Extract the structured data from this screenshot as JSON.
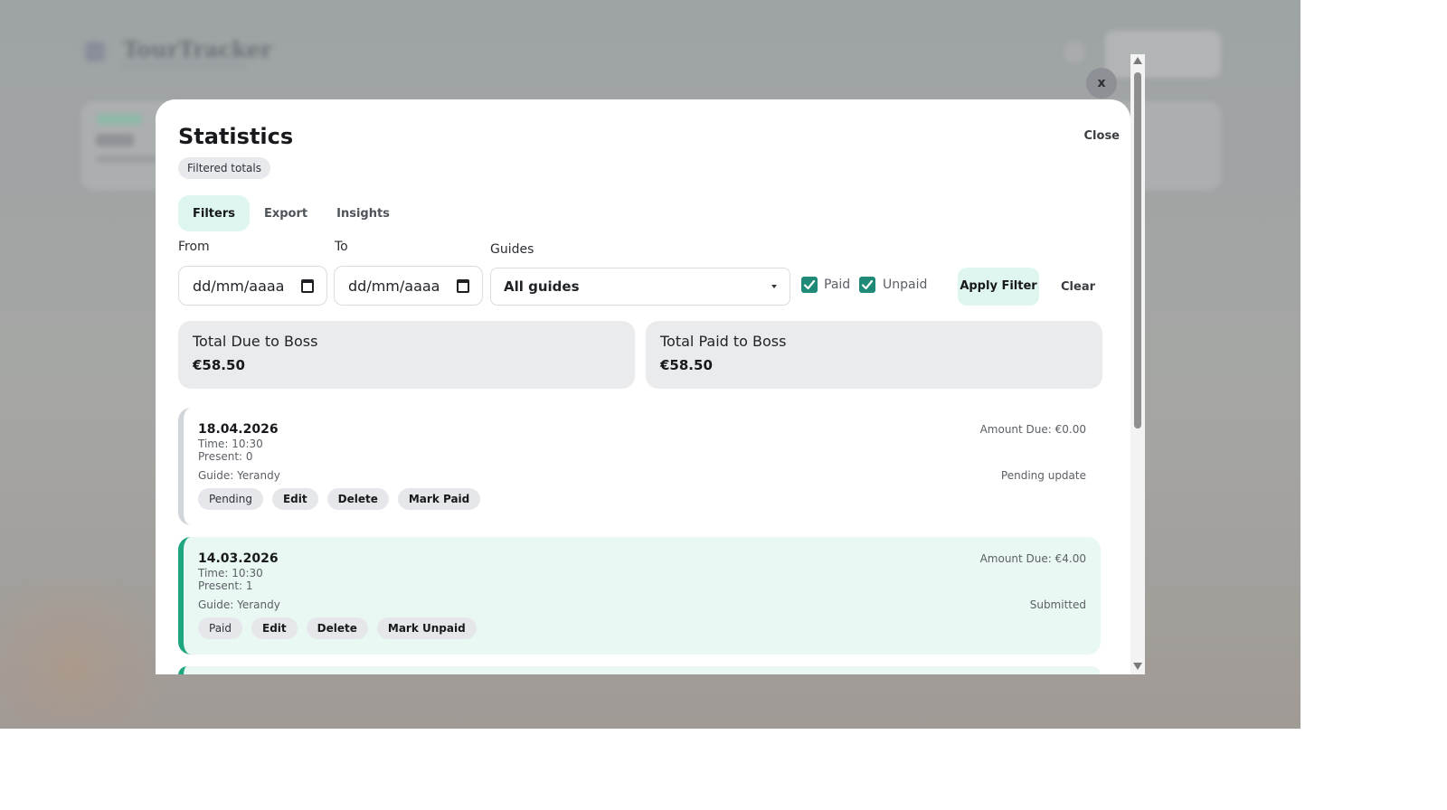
{
  "background": {
    "app_title": "TourTracker"
  },
  "modal": {
    "close_x": "x",
    "title": "Statistics",
    "subtitle_badge": "Filtered totals",
    "close_label": "Close",
    "tabs": [
      {
        "label": "Filters",
        "active": true
      },
      {
        "label": "Export",
        "active": false
      },
      {
        "label": "Insights",
        "active": false
      }
    ],
    "filters": {
      "from_label": "From",
      "from_value": "dd/mm/aaaa",
      "to_label": "To",
      "to_value": "dd/mm/aaaa",
      "guides_label": "Guides",
      "guides_selected": "All guides",
      "paid_label": "Paid",
      "paid_checked": true,
      "unpaid_label": "Unpaid",
      "unpaid_checked": true,
      "apply_label": "Apply Filter",
      "clear_label": "Clear"
    },
    "totals": {
      "due_label": "Total Due to Boss",
      "due_value": "€58.50",
      "paid_label": "Total Paid to Boss",
      "paid_value": "€58.50"
    },
    "entries": [
      {
        "date": "18.04.2026",
        "time": "Time: 10:30",
        "present": "Present: 0",
        "guide": "Guide: Yerandy",
        "amount": "Amount Due: €0.00",
        "status_text": "Pending update",
        "badge": "Pending",
        "edit": "Edit",
        "delete": "Delete",
        "toggle": "Mark Paid"
      },
      {
        "date": "14.03.2026",
        "time": "Time: 10:30",
        "present": "Present: 1",
        "guide": "Guide: Yerandy",
        "amount": "Amount Due: €4.00",
        "status_text": "Submitted",
        "badge": "Paid",
        "edit": "Edit",
        "delete": "Delete",
        "toggle": "Mark Unpaid"
      }
    ]
  },
  "colors": {
    "accent": "#1fa580",
    "accent_soft": "#dff5ef",
    "checkbox": "#1f8a78",
    "card_bg": "#eaebed"
  }
}
